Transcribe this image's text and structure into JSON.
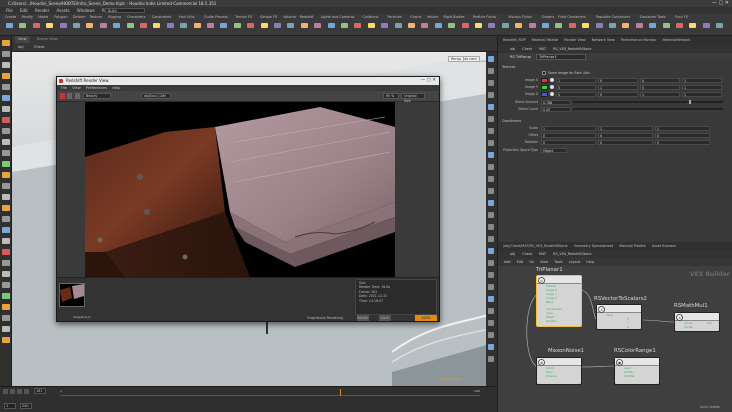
{
  "window": {
    "title": "C:/Users/.../Houdini_Scene/HOBTE/Intro_Scene_Demo.hiplc - Houdini Indie Limited-Commercial 18.5.351"
  },
  "menu": [
    "File",
    "Edit",
    "Render",
    "Assets",
    "Windows",
    "Redshift",
    "Help"
  ],
  "desktop": "Build",
  "shelf_tabs": [
    "Create",
    "Modify",
    "Model",
    "Polygon",
    "Deform",
    "Texture",
    "Rigging",
    "Characters",
    "Constraints",
    "Hair Utils",
    "Guide Process",
    "Terrain FX",
    "Simple FX",
    "Volume",
    "Redshift",
    "Lights and Cameras",
    "Collisions",
    "Particles",
    "Grains",
    "Vellum",
    "Rigid Bodies",
    "Particle Fluids",
    "Viscous Fluids",
    "Oceans",
    "Fluid Containers",
    "Populate Containers",
    "Container Tools",
    "Pyro FX",
    "Sparse Pyro FX",
    "FEM",
    "Wires",
    "Crowds",
    "Drive Simulation"
  ],
  "viewport": {
    "tab": "View",
    "tab2": "Scene View",
    "path_obj": "obj",
    "path_node": "Chest",
    "persp": "Persp",
    "cam": "No cam",
    "no_cam_btn": "Indie Edition"
  },
  "render_view": {
    "title": "Redshift Render View",
    "menu": [
      "File",
      "View",
      "Preferences",
      "Help"
    ],
    "camera": "Beauty",
    "dims": "obj/Soul_CAM",
    "zoom": "95 %",
    "mode": "Original Size",
    "stats": [
      "Render Time: 16.8s",
      "Frame: 161",
      "Date: 2021-12-31",
      "Time: 14:18:57"
    ],
    "stats_header": "Size",
    "snapshot_label": "Snapshot_0",
    "status_left": "Render",
    "status_mid": "Save",
    "status_right": "Progressive Rendering",
    "status_end": "100%"
  },
  "parm_pane": {
    "tabs": [
      "Redshift_ROP",
      "Material Palette",
      "Render View",
      "Network View",
      "Performance Monitor",
      "MaterialNetwork"
    ],
    "path_obj": "obj",
    "path_node": "Chest",
    "path_mat": "MAT",
    "path_rs": "RS_VEX_RedshiftStone",
    "node_type": "RS TriPlanar",
    "node_name": "TriPlanar1",
    "section": "Textures",
    "same_image": "Same Image for Each Axis",
    "rows": [
      {
        "label": "Image X",
        "color": "#e23838",
        "vals": [
          "1",
          "0",
          "0",
          "1"
        ]
      },
      {
        "label": "Image Y",
        "color": "#3bd13b",
        "vals": [
          "0",
          "1",
          "0",
          "1"
        ]
      },
      {
        "label": "Image Z",
        "color": "#3b5de2",
        "vals": [
          "0",
          "0",
          "1",
          "1"
        ]
      }
    ],
    "blend_amount_label": "Blend Amount",
    "blend_amount": "0.788",
    "blend_curve_label": "Blend Curve",
    "blend_curve": "0.45",
    "coord_section": "Coordinates",
    "scale_label": "Scale",
    "scale": [
      "1",
      "1",
      "1"
    ],
    "offset_label": "Offset",
    "offset": [
      "0",
      "0",
      "0"
    ],
    "rotation_label": "Rotation",
    "rotation": [
      "0",
      "0",
      "0"
    ],
    "projection_label": "Projection Space Type",
    "projection": "Object"
  },
  "network": {
    "tabs": [
      "/obj/Chest/MAT/RS_VEX_RedshiftStone",
      "Geometry Spreadsheet",
      "Material Palette",
      "Asset Browser"
    ],
    "path_obj": "obj",
    "path_node": "Chest",
    "path_mat": "MAT",
    "path_rs": "RS_VEX_RedshiftStone",
    "menu": [
      "Add",
      "Edit",
      "Go",
      "View",
      "Tools",
      "Layout",
      "Help"
    ],
    "watermark": "VEX Builder",
    "nodes": [
      {
        "name": "TriPlanar1",
        "icon": "◎",
        "ports": [
          "Texture",
          "Image X",
          "Image Y",
          "Image Z",
          "Blend",
          "Coordinates",
          "Scale",
          "Offset",
          "Rotation"
        ]
      },
      {
        "name": "RSVectorToScalars2",
        "icon": "x",
        "ports": [
          "Input",
          "X",
          "Y",
          "Z"
        ]
      },
      {
        "name": "RSMathMul1",
        "icon": "x",
        "ports": [
          "Input1",
          "Input2",
          "Out"
        ]
      },
      {
        "name": "MaxonNoise1",
        "icon": "⊗",
        "ports": [
          "Coord",
          "Seed",
          "Octaves"
        ]
      },
      {
        "name": "RSColorRange1",
        "icon": "◉",
        "ports": [
          "Input",
          "Old Min",
          "Old Max"
        ]
      }
    ]
  },
  "timeline": {
    "frame_start": "1",
    "frame_current": "161",
    "frame_end": "240",
    "auto_update": "Auto Update"
  },
  "colors": {
    "accent": "#e08a18",
    "selected": "#f0c040"
  }
}
